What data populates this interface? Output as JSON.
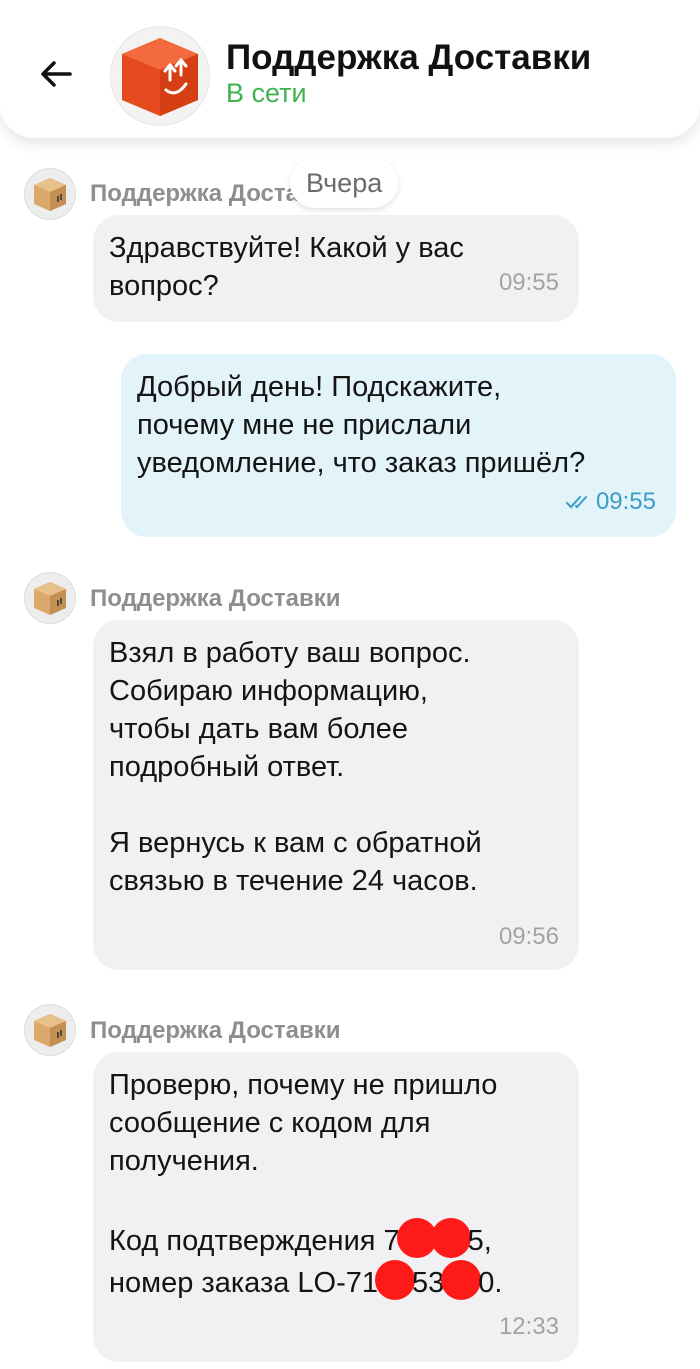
{
  "header": {
    "title": "Поддержка Доставки",
    "status": "В сети",
    "status_color": "#3fb34f",
    "back_icon": "arrow-left-icon",
    "avatar_icon": "package-box-icon"
  },
  "date_separator": "Вчера",
  "messages": [
    {
      "direction": "incoming",
      "sender": "Поддержка Доставки",
      "text": "Здравствуйте! Какой у вас\nвопрос?",
      "time": "09:55"
    },
    {
      "direction": "outgoing",
      "text": "Добрый день! Подскажите,\nпочему мне не прислали\nуведомление, что заказ пришёл?",
      "time": "09:55",
      "status_icon": "double-check-icon"
    },
    {
      "direction": "incoming",
      "sender": "Поддержка Доставки",
      "text": "Взял в работу ваш вопрос.\nСобираю информацию,\nчтобы дать вам более\nподробный ответ.\n\nЯ вернусь к вам с обратной\nсвязью в течение 24 часов.",
      "time": "09:56"
    },
    {
      "direction": "incoming",
      "sender": "Поддержка Доставки",
      "text_intro": "Проверю, почему не пришло\nсообщение с кодом для\nполучения.",
      "code_label": "Код подтверждения 7",
      "code_end": "5,",
      "order_label": "номер заказа LO-71",
      "order_mid": "53",
      "order_end": "0.",
      "time": "12:33"
    }
  ],
  "colors": {
    "incoming_bubble": "#f1f1f3",
    "outgoing_bubble": "#e2f3f9",
    "outgoing_time": "#3b9cc9",
    "redaction": "#ff1a1a"
  }
}
